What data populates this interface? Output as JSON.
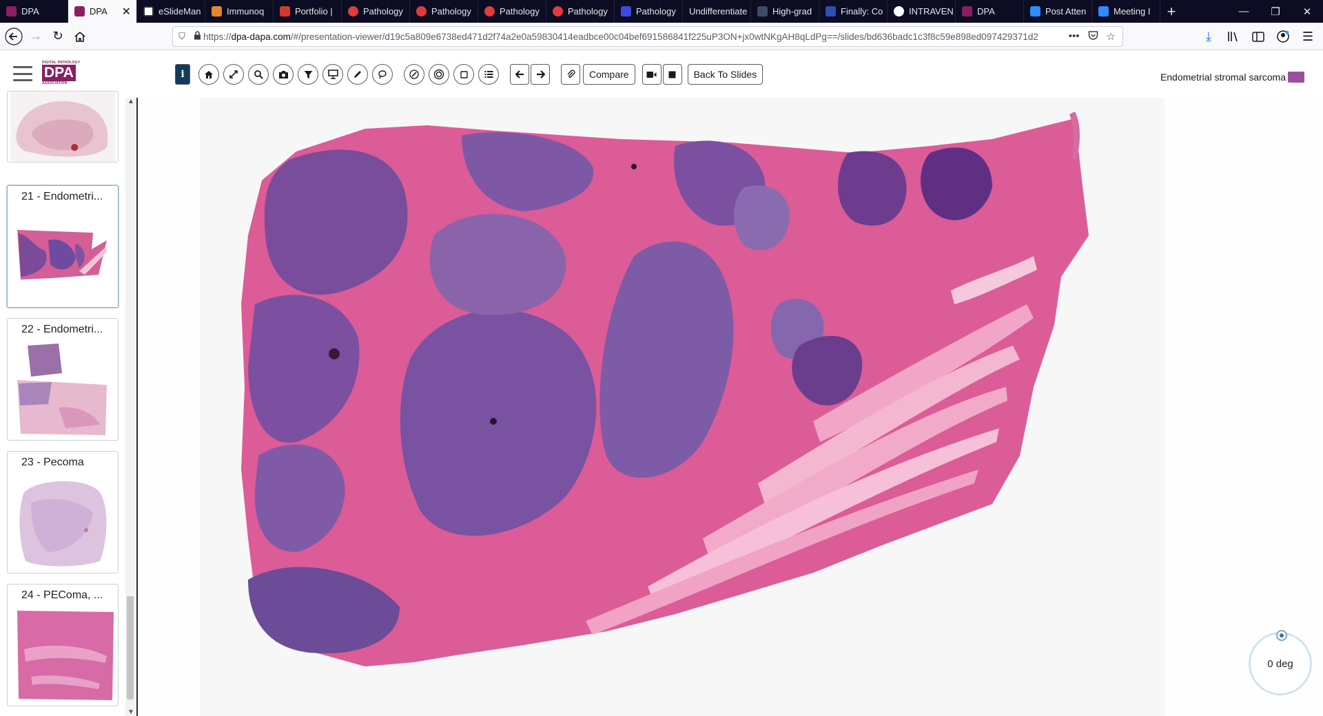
{
  "browser": {
    "tabs": [
      {
        "label": "DPA",
        "color": "#8a1f63"
      },
      {
        "label": "DPA",
        "color": "#8a1f63",
        "active": true
      },
      {
        "label": "eSlideMan",
        "color": "#ffffff"
      },
      {
        "label": "Immunoq",
        "color": "#e8862a"
      },
      {
        "label": "Portfolio |",
        "color": "#d43a2a"
      },
      {
        "label": "Pathology",
        "color": "#e23b3b"
      },
      {
        "label": "Pathology",
        "color": "#e23b3b"
      },
      {
        "label": "Pathology",
        "color": "#e23b3b"
      },
      {
        "label": "Pathology",
        "color": "#e23b3b"
      },
      {
        "label": "Pathology",
        "color": "#3b4be2"
      },
      {
        "label": "Undifferentiate",
        "color": ""
      },
      {
        "label": "High-grad",
        "color": "#3d4b66"
      },
      {
        "label": "Finally: Co",
        "color": "#2f4fb4"
      },
      {
        "label": "INTRAVEN",
        "color": "#ffffff"
      },
      {
        "label": "DPA",
        "color": "#8a1f63"
      },
      {
        "label": "Post Atten",
        "color": "#2d8cff"
      },
      {
        "label": "Meeting I",
        "color": "#2d8cff"
      }
    ],
    "new_tab": "+",
    "url_prefix": "https://",
    "url_domain": "dpa-dapa.com",
    "url_rest": "/#/presentation-viewer/d19c5a809e6738ed471d2f74a2e0a59830414eadbce00c04bef691586841f225uP3ON+jx0wtNKgAH8qLdPg==/slides/bd636badc1c3f8c59e898ed097429371d2",
    "url_more": "•••"
  },
  "app": {
    "logo_small": "DIGITAL PATHOLOGY",
    "logo_main": "DPA",
    "logo_sub": "ASSOCIATION",
    "toolbar": {
      "info": "i",
      "compare": "Compare",
      "back_to_slides": "Back To Slides"
    },
    "case_title": "Endometrial stromal sarcoma",
    "accent": "#8a1f63"
  },
  "slides": [
    {
      "label": ""
    },
    {
      "label": "21 - Endometri...",
      "active": true
    },
    {
      "label": "22 - Endometri..."
    },
    {
      "label": "23 - Pecoma"
    },
    {
      "label": "24 - PEComa, ..."
    }
  ],
  "viewer": {
    "rotation": "0 deg"
  }
}
